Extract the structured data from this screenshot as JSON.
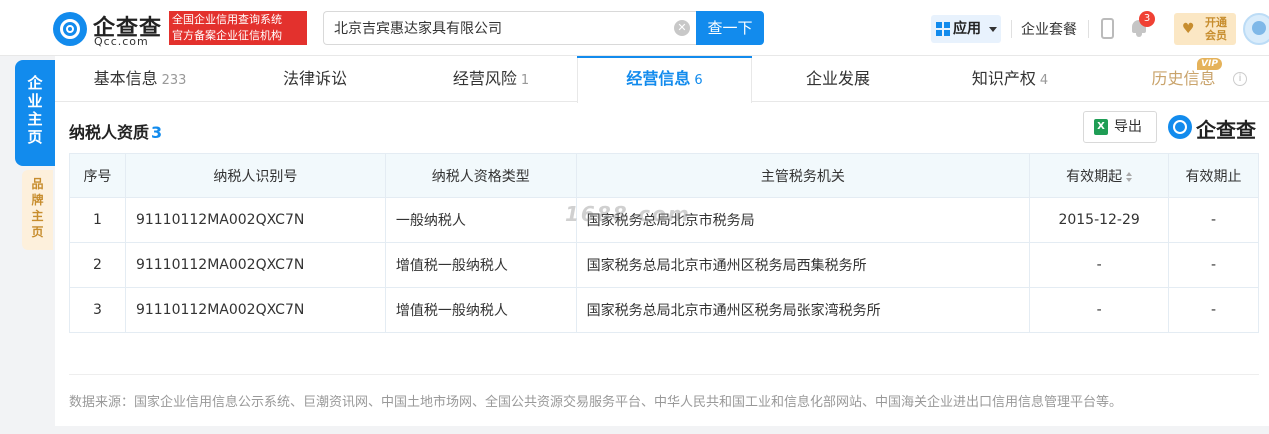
{
  "header": {
    "logo_text": "企查查",
    "logo_sub": "Qcc.com",
    "badge_line1": "全国企业信用查询系统",
    "badge_line2": "官方备案企业征信机构",
    "search_value": "北京吉宾惠达家具有限公司",
    "search_button": "查一下",
    "apps_label": "应用",
    "package_label": "企业套餐",
    "notification_count": "3",
    "vip_label_line1": "开通",
    "vip_label_line2": "会员"
  },
  "left_tabs": {
    "main": "企业主页",
    "brand": "品牌主页"
  },
  "tabs": [
    {
      "label": "基本信息",
      "count": "233"
    },
    {
      "label": "法律诉讼",
      "count": ""
    },
    {
      "label": "经营风险",
      "count": "1"
    },
    {
      "label": "经营信息",
      "count": "6"
    },
    {
      "label": "企业发展",
      "count": ""
    },
    {
      "label": "知识产权",
      "count": "4"
    },
    {
      "label": "历史信息",
      "count": ""
    }
  ],
  "vip_tag": "VIP",
  "section": {
    "title": "纳税人资质",
    "count": "3",
    "export_label": "导出",
    "brand_text": "企查查"
  },
  "table": {
    "headers": [
      "序号",
      "纳税人识别号",
      "纳税人资格类型",
      "主管税务机关",
      "有效期起",
      "有效期止"
    ],
    "rows": [
      [
        "1",
        "91110112MA002QXC7N",
        "一般纳税人",
        "国家税务总局北京市税务局",
        "2015-12-29",
        "-"
      ],
      [
        "2",
        "91110112MA002QXC7N",
        "增值税一般纳税人",
        "国家税务总局北京市通州区税务局西集税务所",
        "-",
        "-"
      ],
      [
        "3",
        "91110112MA002QXC7N",
        "增值税一般纳税人",
        "国家税务总局北京市通州区税务局张家湾税务所",
        "-",
        "-"
      ]
    ]
  },
  "watermark": "1688.com",
  "source_text": "数据来源：国家企业信用信息公示系统、巨潮资讯网、中国土地市场网、全国公共资源交易服务平台、中华人民共和国工业和信息化部网站、中国海关企业进出口信用信息管理平台等。",
  "colors": {
    "primary": "#128bed",
    "badge_red": "#e3312d",
    "vip_gold": "#c78d2e"
  }
}
